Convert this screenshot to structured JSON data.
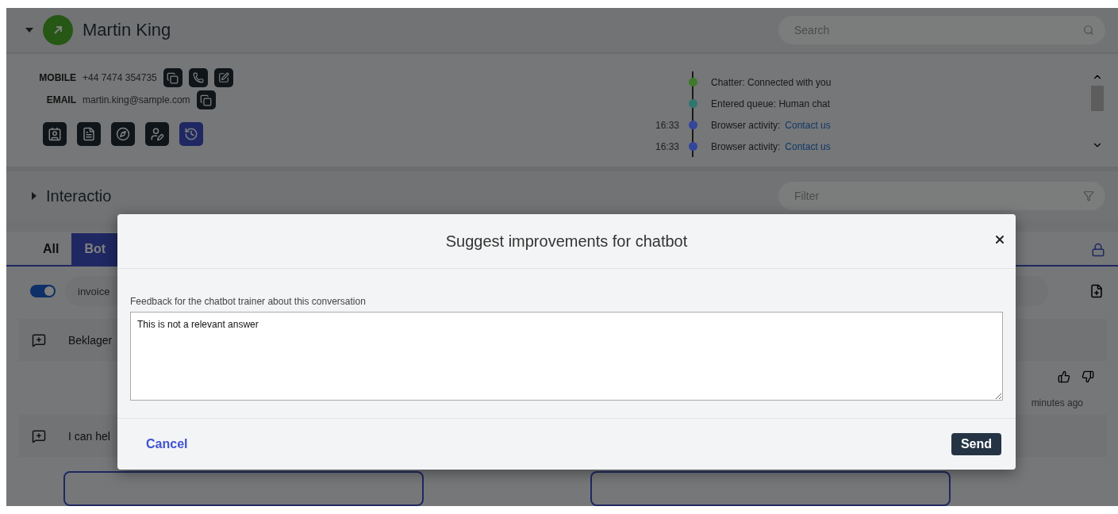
{
  "header": {
    "name": "Martin King",
    "search": {
      "placeholder": "Search"
    }
  },
  "contact": {
    "fields": [
      {
        "label": "MOBILE",
        "value": "+44 7474 354735",
        "actions": [
          {
            "kind": "copy"
          },
          {
            "kind": "call"
          },
          {
            "kind": "edit"
          }
        ]
      },
      {
        "label": "EMAIL",
        "value": "martin.king@sample.com",
        "actions": [
          {
            "kind": "copy"
          }
        ]
      }
    ],
    "tools": [
      {
        "kind": "contact",
        "selected": false
      },
      {
        "kind": "notes",
        "selected": false
      },
      {
        "kind": "compass",
        "selected": false
      },
      {
        "kind": "user-edit",
        "selected": false
      },
      {
        "kind": "history",
        "selected": true
      }
    ]
  },
  "timeline": [
    {
      "text": "Chatter: Connected with you",
      "color": "#3f7a2a"
    },
    {
      "text": "Entered queue:  Human chat",
      "color": "#2f7670"
    },
    {
      "time": "16:33",
      "text": "Browser activity:",
      "link": "Contact us",
      "color": "#34469a"
    },
    {
      "time": "16:33",
      "text": "Browser activity:",
      "link": "Contact us",
      "color": "#34469a"
    }
  ],
  "interactions": {
    "title": "Interactio",
    "filter": {
      "placeholder": "Filter"
    }
  },
  "tabs": [
    {
      "label": "All",
      "selected": false
    },
    {
      "label": "Bot",
      "selected": true
    }
  ],
  "toggle": {
    "on": true
  },
  "tag_field": {
    "value": "invoice"
  },
  "messages": [
    {
      "text": "Beklager"
    },
    {
      "text": "I can hel"
    }
  ],
  "message_time": "minutes ago",
  "dialog": {
    "title": "Suggest improvements for chatbot",
    "field_label": "Feedback for the chatbot trainer about this conversation",
    "value": "This is not a relevant answer",
    "cancel": "Cancel",
    "send": "Send"
  }
}
